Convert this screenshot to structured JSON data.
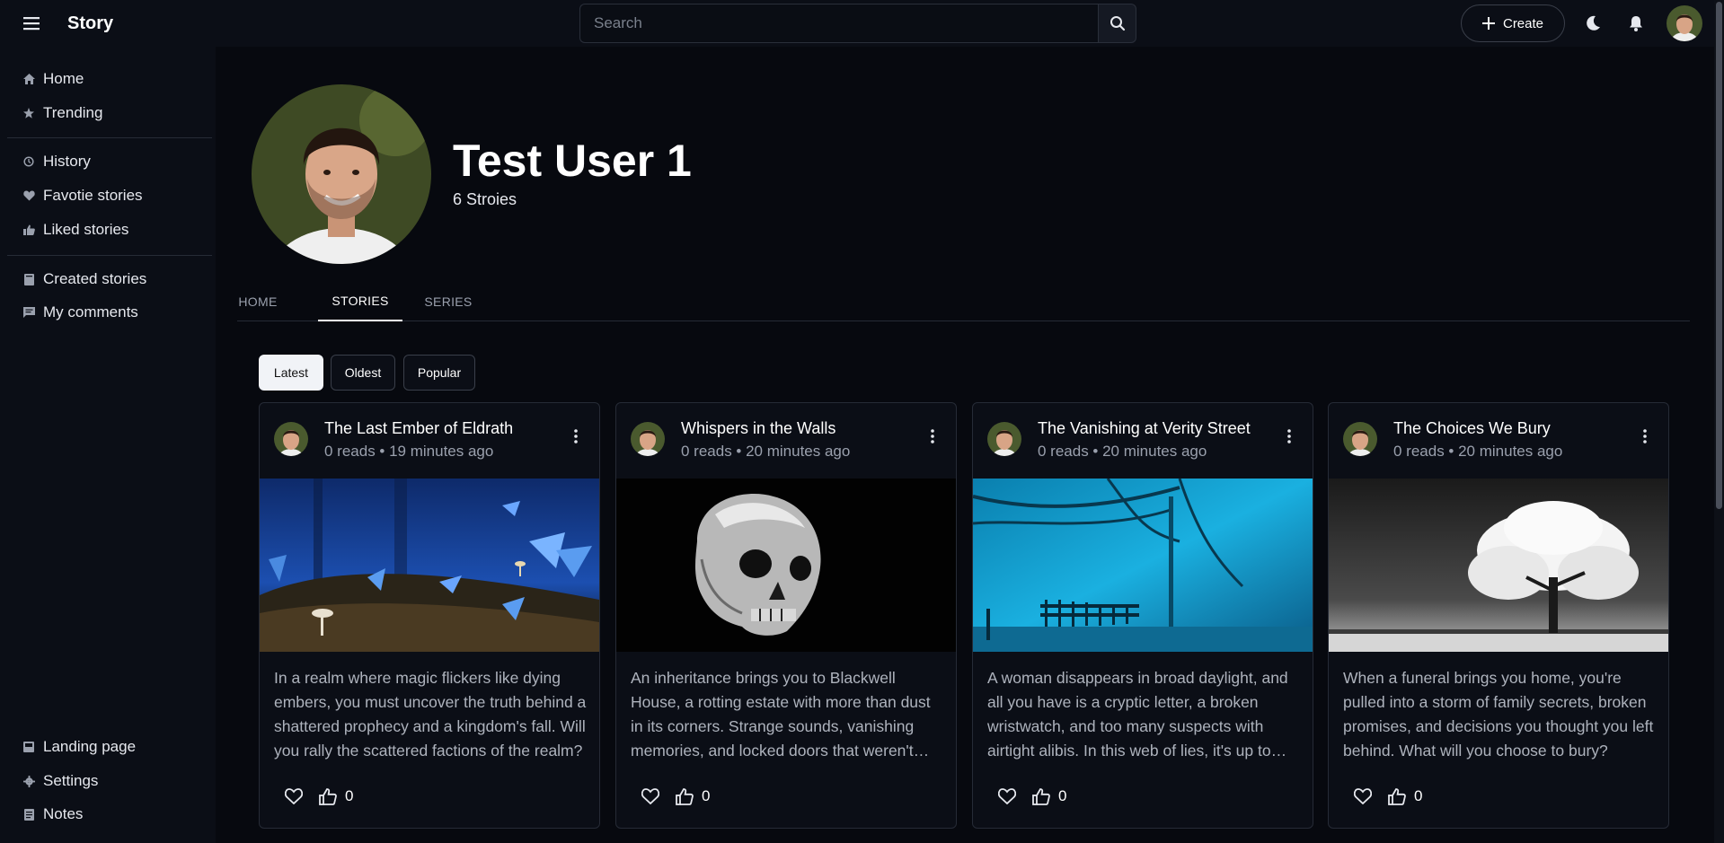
{
  "app": {
    "title": "Story"
  },
  "header": {
    "search_placeholder": "Search",
    "create_label": "Create",
    "icons": [
      "menu-icon",
      "search-icon",
      "plus-icon",
      "moon-icon",
      "bell-icon"
    ]
  },
  "sidebar": {
    "items": [
      {
        "label": "Home",
        "icon": "home-icon"
      },
      {
        "label": "Trending",
        "icon": "star-icon"
      },
      {
        "label": "History",
        "icon": "history-icon"
      },
      {
        "label": "Favotie stories",
        "icon": "heart-icon"
      },
      {
        "label": "Liked stories",
        "icon": "thumb-up-icon"
      },
      {
        "label": "Created stories",
        "icon": "book-icon"
      },
      {
        "label": "My comments",
        "icon": "comment-icon"
      },
      {
        "label": "Landing page",
        "icon": "landing-icon"
      },
      {
        "label": "Settings",
        "icon": "gear-icon"
      },
      {
        "label": "Notes",
        "icon": "notes-icon"
      }
    ]
  },
  "profile": {
    "name": "Test User 1",
    "story_count": "6 Stroies"
  },
  "tabs": [
    {
      "label": "HOME",
      "active": false
    },
    {
      "label": "STORIES",
      "active": true
    },
    {
      "label": "SERIES",
      "active": false
    }
  ],
  "filters": [
    {
      "label": "Latest",
      "active": true
    },
    {
      "label": "Oldest",
      "active": false
    },
    {
      "label": "Popular",
      "active": false
    }
  ],
  "cards": [
    {
      "title": "The Last Ember of Eldrath",
      "meta": "0 reads • 19 minutes ago",
      "description": "In a realm where magic flickers like dying embers, you must uncover the truth behind a shattered prophecy and a kingdom's fall. Will you rally the scattered factions of the realm?",
      "likes": "0"
    },
    {
      "title": "Whispers in the Walls",
      "meta": "0 reads • 20 minutes ago",
      "description": "An inheritance brings you to Blackwell House, a rotting estate with more than dust in its corners. Strange sounds, vanishing memories, and locked doors that weren't there before.",
      "likes": "0"
    },
    {
      "title": "The Vanishing at Verity Street",
      "meta": "0 reads • 20 minutes ago",
      "description": "A woman disappears in broad daylight, and all you have is a cryptic letter, a broken wristwatch, and too many suspects with airtight alibis. In this web of lies, it's up to you.",
      "likes": "0"
    },
    {
      "title": "The Choices We Bury",
      "meta": "0 reads • 20 minutes ago",
      "description": "When a funeral brings you home, you're pulled into a storm of family secrets, broken promises, and decisions you thought you left behind. What will you choose to bury?",
      "likes": "0"
    }
  ],
  "colors": {
    "background": "#07090f",
    "panel": "#0b0e16",
    "border": "#262b36",
    "text": "#e6e8ee",
    "muted": "#9aa0ad"
  }
}
